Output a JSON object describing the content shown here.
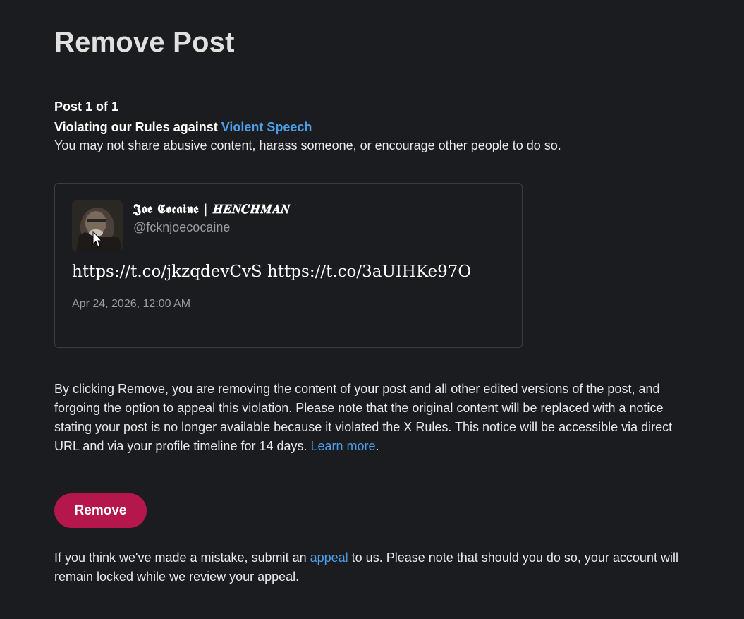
{
  "page": {
    "title": "Remove Post"
  },
  "violation": {
    "post_count": "Post 1 of 1",
    "rule_prefix": "Violating our Rules against ",
    "rule_link": "Violent Speech",
    "description": "You may not share abusive content, harass someone, or encourage other people to do so."
  },
  "post": {
    "display_name": "𝕵𝖔𝖊 𝕮𝖔𝖈𝖆𝖎𝖓𝖊 | 𝑯𝑬𝑵𝑪𝑯𝑴𝑨𝑵",
    "handle": "@fcknjoecocaine",
    "text": "https://t.co/jkzqdevCvS https://t.co/3aUIHKe97O",
    "date": "Apr 24, 2026, 12:00 AM"
  },
  "notice": {
    "body": "By clicking Remove, you are removing the content of your post and all other edited versions of the post, and forgoing the option to appeal this violation. Please note that the original content will be replaced with a notice stating your post is no longer available because it violated the X Rules. This notice will be accessible via direct URL and via your profile timeline for 14 days. ",
    "learn_more": "Learn more",
    "period": "."
  },
  "actions": {
    "remove_label": "Remove"
  },
  "appeal": {
    "prefix": "If you think we've made a mistake, submit an ",
    "link": "appeal",
    "suffix": " to us. Please note that should you do so, your account will remain locked while we review your appeal."
  },
  "colors": {
    "background": "#1b1c1f",
    "link": "#4a9fe8",
    "remove_button": "#b5164b",
    "card_border": "#3a3c40",
    "muted_text": "#9a9da2"
  }
}
